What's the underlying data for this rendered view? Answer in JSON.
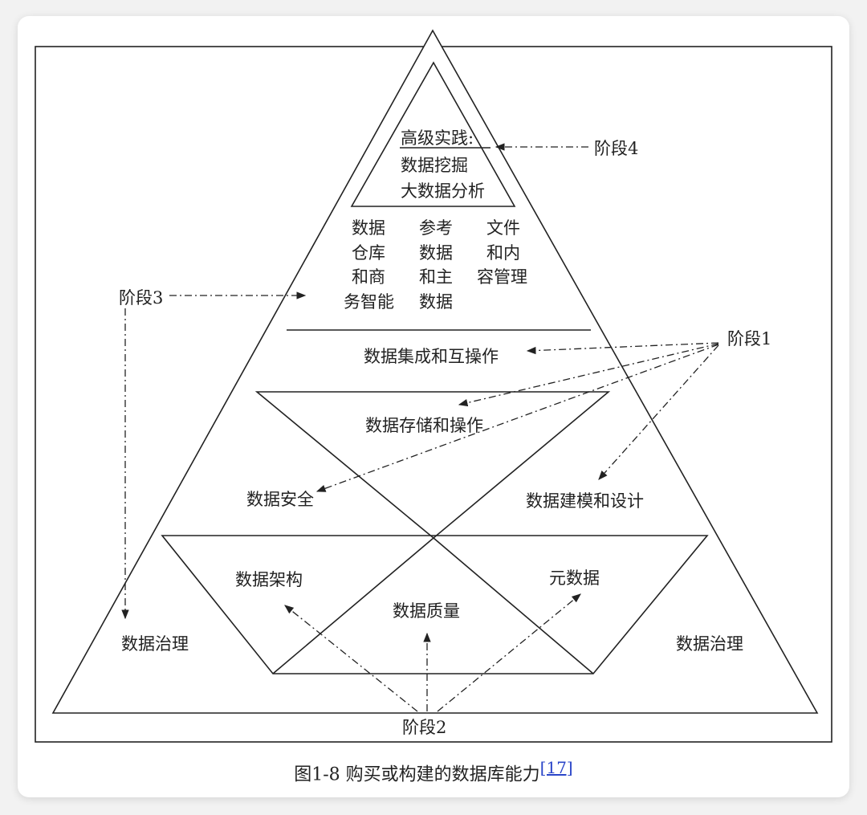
{
  "labels": {
    "top_heading": "高级实践:",
    "top_line2": "数据挖掘",
    "top_line3": "大数据分析",
    "stage4": "阶段4",
    "stage3": "阶段3",
    "stage1": "阶段1",
    "stage2": "阶段2",
    "col1": [
      "数据",
      "仓库",
      "和商",
      "务智能"
    ],
    "col2": [
      "参考",
      "数据",
      "和主",
      "数据"
    ],
    "col3": [
      "文件",
      "和内",
      "容管理"
    ],
    "integration": "数据集成和互操作",
    "storage": "数据存储和操作",
    "security": "数据安全",
    "modeling": "数据建模和设计",
    "architecture": "数据架构",
    "metadata": "元数据",
    "quality": "数据质量",
    "governance_left": "数据治理",
    "governance_right": "数据治理"
  },
  "caption": {
    "text": "图1-8 购买或构建的数据库能力",
    "ref": "[17]"
  },
  "colors": {
    "line": "#222222",
    "link": "#2a45c8"
  }
}
